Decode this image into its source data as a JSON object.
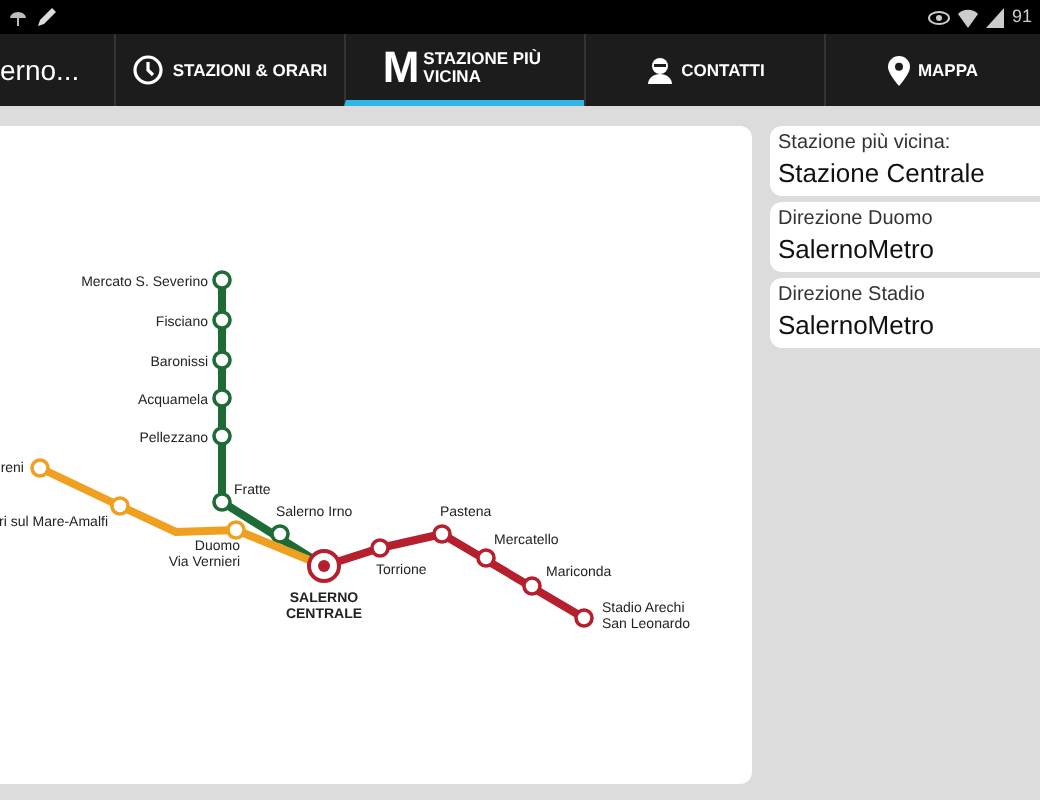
{
  "status_bar": {
    "battery_text": "91"
  },
  "action_bar": {
    "title": "erno..."
  },
  "tabs": [
    {
      "label": "STAZIONI & ORARI",
      "kind": "clock",
      "selected": false
    },
    {
      "label": "STAZIONE PIÙ VICINA",
      "kind": "logo",
      "logo": "M",
      "selected": true
    },
    {
      "label": "CONTATTI",
      "kind": "person",
      "selected": false
    },
    {
      "label": "MAPPA",
      "kind": "pin",
      "selected": false
    }
  ],
  "map": {
    "lines": [
      {
        "color": "#1e6b35",
        "stations": [
          {
            "label": [
              "Mercato S. Severino"
            ]
          },
          {
            "label": [
              "Fisciano"
            ]
          },
          {
            "label": [
              "Baronissi"
            ]
          },
          {
            "label": [
              "Acquamela"
            ]
          },
          {
            "label": [
              "Pellezzano"
            ]
          },
          {
            "label": [
              "Fratte"
            ]
          },
          {
            "label": [
              "Salerno Irno"
            ]
          }
        ]
      },
      {
        "color": "#f0a020",
        "stations": [
          {
            "label": [
              "reni"
            ]
          },
          {
            "label": [
              "ri sul Mare-Amalfi"
            ]
          },
          {
            "label": [
              "Duomo",
              "Via Vernieri"
            ]
          }
        ]
      },
      {
        "color": "#b51f2e",
        "stations": [
          {
            "label": [
              "Torrione"
            ]
          },
          {
            "label": [
              "Pastena"
            ]
          },
          {
            "label": [
              "Mercatello"
            ]
          },
          {
            "label": [
              "Mariconda"
            ]
          },
          {
            "label": [
              "Stadio Arechi",
              "San Leonardo"
            ]
          }
        ]
      }
    ],
    "hub": {
      "label": [
        "SALERNO",
        "CENTRALE"
      ]
    }
  },
  "info_cards": [
    {
      "caption": "Stazione più vicina:",
      "value": "Stazione Centrale"
    },
    {
      "caption": "Direzione Duomo",
      "value": "SalernoMetro"
    },
    {
      "caption": "Direzione Stadio",
      "value": "SalernoMetro"
    }
  ]
}
